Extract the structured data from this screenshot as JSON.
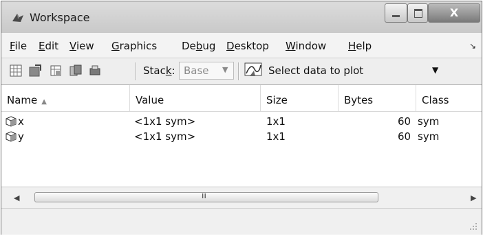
{
  "window": {
    "title": "Workspace",
    "close_label": "X"
  },
  "menu": {
    "items": [
      "File",
      "Edit",
      "View",
      "Graphics",
      "Debug",
      "Desktop",
      "Window",
      "Help"
    ],
    "underline": [
      "F",
      "E",
      "V",
      "G",
      "b",
      "D",
      "W",
      "H"
    ]
  },
  "toolbar": {
    "stack_label": "Stack:",
    "stack_value": "Base",
    "plot_select_value": "Select data to plot"
  },
  "table": {
    "columns": [
      "Name",
      "Value",
      "Size",
      "Bytes",
      "Class"
    ],
    "rows": [
      {
        "name": "x",
        "value": "<1x1 sym>",
        "size": "1x1",
        "bytes": "60",
        "class": "sym"
      },
      {
        "name": "y",
        "value": "<1x1 sym>",
        "size": "1x1",
        "bytes": "60",
        "class": "sym"
      }
    ]
  },
  "scrollbar": {
    "grip": "III"
  },
  "colors": {
    "titlebar": "#d4d4d4",
    "window_bg": "#f0f0f0",
    "table_bg": "#ffffff"
  }
}
